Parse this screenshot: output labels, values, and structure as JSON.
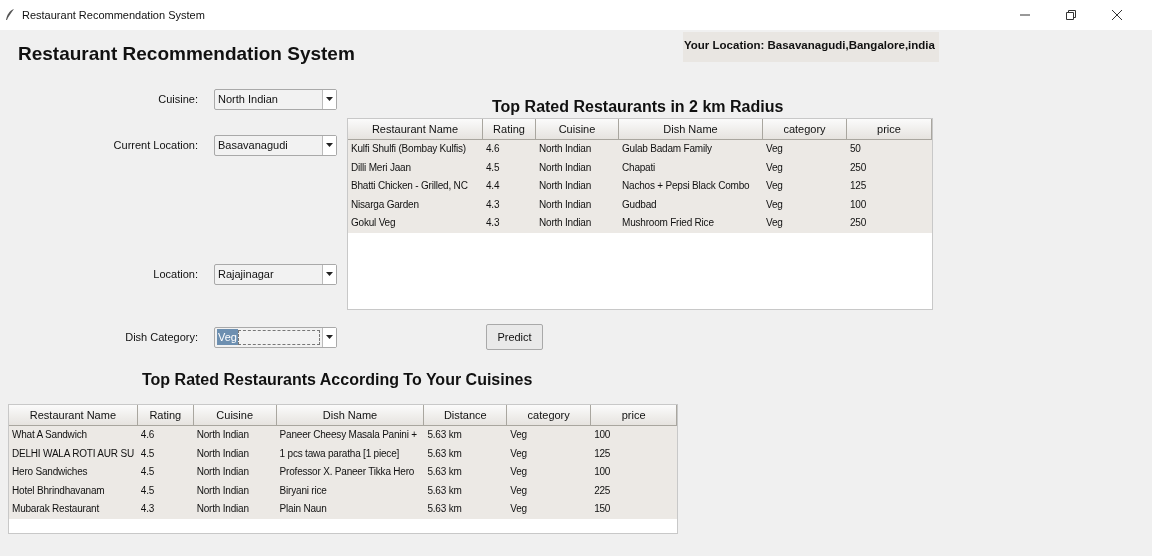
{
  "window": {
    "title": "Restaurant Recommendation System"
  },
  "app_title": "Restaurant Recommendation System",
  "your_location": "Your Location: Basavanagudi,Bangalore,india",
  "fields": [
    {
      "label": "Cuisine:",
      "value": "North Indian",
      "focused": false
    },
    {
      "label": "Current Location:",
      "value": "Basavanagudi",
      "focused": false
    },
    {
      "label": "Location:",
      "value": "Rajajinagar",
      "focused": false
    },
    {
      "label": "Dish Category:",
      "value": "Veg",
      "focused": true
    }
  ],
  "nearby": {
    "heading": "Top Rated Restaurants in 2 km Radius",
    "columns": [
      "Restaurant Name",
      "Rating",
      "Cuisine",
      "Dish Name",
      "category",
      "price"
    ],
    "rows": [
      [
        "Kulfi Shulfi (Bombay Kulfis)",
        "4.6",
        "North Indian",
        "Gulab Badam Family",
        "Veg",
        "50"
      ],
      [
        "Dilli Meri Jaan",
        "4.5",
        "North Indian",
        "Chapati",
        "Veg",
        "250"
      ],
      [
        "Bhatti Chicken - Grilled, NC",
        "4.4",
        "North Indian",
        "Nachos + Pepsi Black Combo",
        "Veg",
        "125"
      ],
      [
        "Nisarga Garden",
        "4.3",
        "North Indian",
        "Gudbad",
        "Veg",
        "100"
      ],
      [
        "Gokul Veg",
        "4.3",
        "North Indian",
        "Mushroom Fried Rice",
        "Veg",
        "250"
      ]
    ]
  },
  "predict_button": "Predict",
  "by_cuisine": {
    "heading": "Top Rated Restaurants According To Your Cuisines",
    "columns": [
      "Restaurant Name",
      "Rating",
      "Cuisine",
      "Dish Name",
      "Distance",
      "category",
      "price"
    ],
    "rows": [
      [
        "What A Sandwich",
        "4.6",
        "North Indian",
        "Paneer Cheesy Masala Panini +",
        "5.63 km",
        "Veg",
        "100"
      ],
      [
        "DELHI WALA ROTI AUR SU",
        "4.5",
        "North Indian",
        "1 pcs tawa paratha [1 piece]",
        "5.63 km",
        "Veg",
        "125"
      ],
      [
        "Hero Sandwiches",
        "4.5",
        "North Indian",
        "Professor X. Paneer Tikka Hero",
        "5.63 km",
        "Veg",
        "100"
      ],
      [
        "Hotel Bhrindhavanam",
        "4.5",
        "North Indian",
        "Biryani rice",
        "5.63 km",
        "Veg",
        "225"
      ],
      [
        "Mubarak Restaurant",
        "4.3",
        "North Indian",
        "Plain Naun",
        "5.63 km",
        "Veg",
        "150"
      ]
    ]
  }
}
